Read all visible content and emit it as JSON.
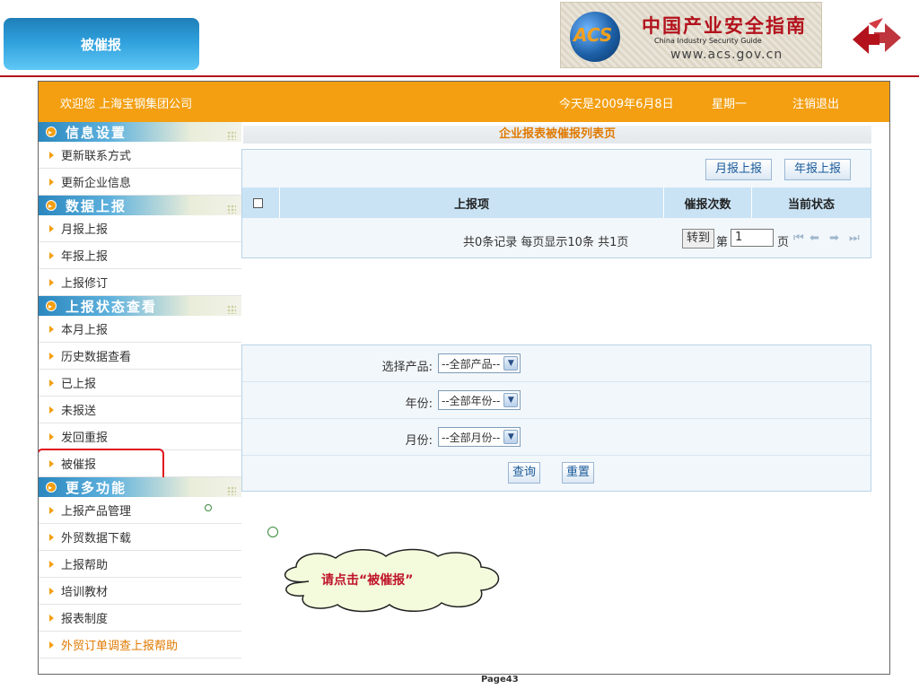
{
  "slide": {
    "title": "被催报",
    "logo_cn": "中国产业安全指南",
    "logo_en": "China  Industry  Security  Guide",
    "logo_url": "www.acs.gov.cn",
    "logo_acs": "ACS",
    "page_number": "Page43"
  },
  "topbar": {
    "welcome": "欢迎您  上海宝钢集团公司",
    "date": "今天是2009年6月8日",
    "weekday": "星期一",
    "logout": "注销退出"
  },
  "sidebar": {
    "sections": [
      {
        "title": "信息设置",
        "items": [
          "更新联系方式",
          "更新企业信息"
        ]
      },
      {
        "title": "数据上报",
        "items": [
          "月报上报",
          "年报上报",
          "上报修订"
        ]
      },
      {
        "title": "上报状态查看",
        "items": [
          "本月上报",
          "历史数据查看",
          "已上报",
          "未报送",
          "发回重报",
          "被催报"
        ]
      },
      {
        "title": "更多功能",
        "items": [
          "上报产品管理",
          "外贸数据下载",
          "上报帮助",
          "培训教材",
          "报表制度",
          "外贸订单调查上报帮助"
        ]
      }
    ]
  },
  "main": {
    "heading": "企业报表被催报列表页",
    "buttons": {
      "monthly": "月报上报",
      "annual": "年报上报"
    },
    "table": {
      "columns": [
        "上报项",
        "催报次数",
        "当前状态"
      ]
    },
    "pager": {
      "summary": "共0条记录  每页显示10条  共1页",
      "goto": "转到",
      "pre": "第",
      "page_value": "1",
      "post": "页"
    },
    "query": {
      "product_label": "选择产品:",
      "product_value": "--全部产品--",
      "year_label": "年份:",
      "year_value": "--全部年份--",
      "month_label": "月份:",
      "month_value": "--全部月份--",
      "search": "查询",
      "reset": "重置"
    }
  },
  "annotation": {
    "text": "请点击“被催报”"
  },
  "colors": {
    "accent_orange": "#f39f11",
    "header_blue": "#c9e3f5",
    "highlight_red": "#e0101d"
  }
}
